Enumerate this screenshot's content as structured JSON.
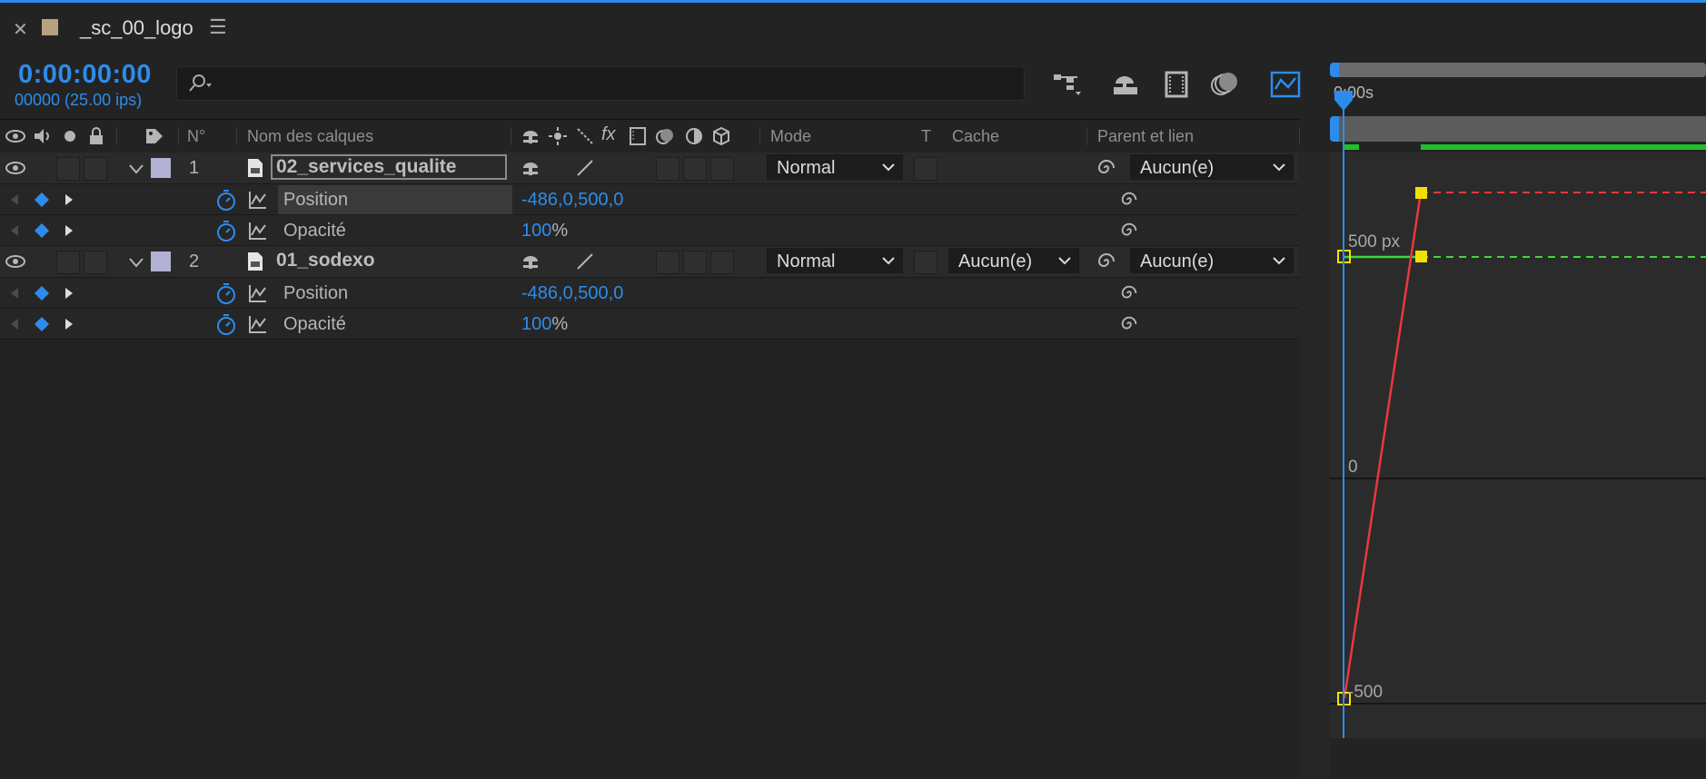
{
  "tab": {
    "title": "_sc_00_logo",
    "close_icon": "close-icon",
    "menu_icon": "hamburger-menu-icon",
    "swatch_color": "#b6a181"
  },
  "timeline": {
    "timecode": "0:00:00:00",
    "frames": "00000 (25.00 ips)"
  },
  "search": {
    "value": "",
    "placeholder": ""
  },
  "toolbar": {
    "icons": [
      "composition-flowchart-icon",
      "draft-3d-icon",
      "frame-blending-icon",
      "motion-blur-icon",
      "graph-editor-icon"
    ]
  },
  "columns": {
    "number": "N°",
    "layer_name": "Nom des calques",
    "mode": "Mode",
    "t": "T",
    "cache": "Cache",
    "parent": "Parent et lien"
  },
  "layers": [
    {
      "number": "1",
      "name": "02_services_qualite",
      "label_color": "#b3b1d4",
      "mode": "Normal",
      "cache": "",
      "parent": "Aucun(e)",
      "props": [
        {
          "name": "Position",
          "value": "-486,0,500,0",
          "unit": ""
        },
        {
          "name": "Opacité",
          "value": "100",
          "unit": "%"
        }
      ]
    },
    {
      "number": "2",
      "name": "01_sodexo",
      "label_color": "#b3b1d4",
      "mode": "Normal",
      "cache": "Aucun(e)",
      "parent": "Aucun(e)",
      "props": [
        {
          "name": "Position",
          "value": "-486,0,500,0",
          "unit": ""
        },
        {
          "name": "Opacité",
          "value": "100",
          "unit": "%"
        }
      ]
    }
  ],
  "graph": {
    "time_label": "0:00s",
    "value_labels": [
      "500 px",
      "0",
      "-500"
    ],
    "curve_colors": {
      "x": "#e8383d",
      "y": "#3ed63e"
    }
  }
}
